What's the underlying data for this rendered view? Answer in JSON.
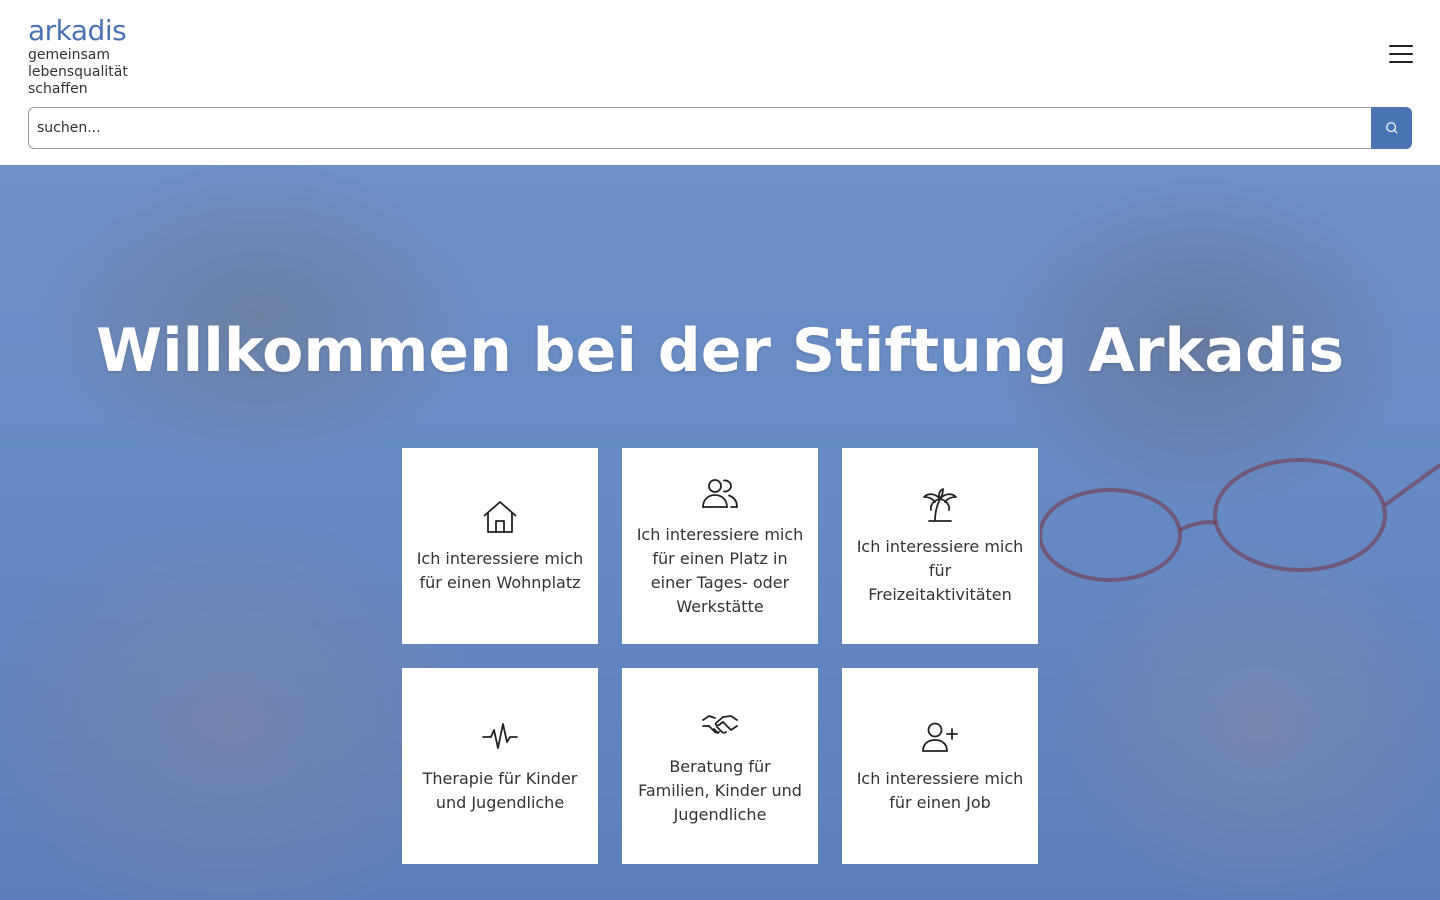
{
  "logo": {
    "word": "arkadis",
    "tagline": [
      "gemeinsam",
      "lebensqualität",
      "schaffen"
    ]
  },
  "header": {
    "menu_icon": "hamburger-menu-icon"
  },
  "search": {
    "placeholder": "suchen...",
    "value": "",
    "button_icon": "search-icon"
  },
  "hero": {
    "title": "Willkommen bei der Stiftung Arkadis"
  },
  "tiles": [
    {
      "icon": "house-icon",
      "label": "Ich interessiere mich für einen Wohnplatz"
    },
    {
      "icon": "users-icon",
      "label": "Ich interessiere mich für einen Platz in einer Tages- oder Werkstätte"
    },
    {
      "icon": "palm-tree-icon",
      "label": "Ich interessiere mich für Freizeitaktivitäten"
    },
    {
      "icon": "pulse-icon",
      "label": "Therapie für Kinder und Jugendliche"
    },
    {
      "icon": "handshake-icon",
      "label": "Beratung für Familien, Kinder und Jugendliche"
    },
    {
      "icon": "user-plus-icon",
      "label": "Ich interessiere mich für einen Job"
    }
  ],
  "colors": {
    "brand": "#4a73b4",
    "text": "#333333",
    "tile_background": "#ffffff"
  }
}
